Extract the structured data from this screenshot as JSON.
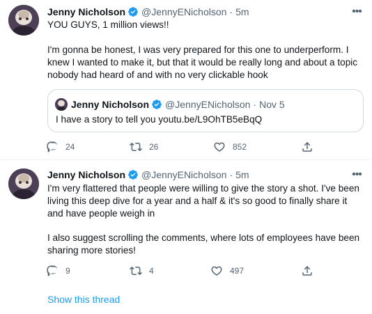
{
  "tweets": [
    {
      "author": "Jenny Nicholson",
      "handle": "@JennyENicholson",
      "time": "5m",
      "paragraphs": [
        "YOU GUYS, 1 million views!!",
        "I'm gonna be honest, I was very prepared for this one to underperform. I knew I wanted to make it, but that it would be really long and about a topic nobody had heard of and with no very clickable hook"
      ],
      "quote": {
        "author": "Jenny Nicholson",
        "handle": "@JennyENicholson",
        "time": "Nov 5",
        "text": "I have a story to tell you youtu.be/L9OhTB5eBqQ"
      },
      "replies": "24",
      "retweets": "26",
      "likes": "852"
    },
    {
      "author": "Jenny Nicholson",
      "handle": "@JennyENicholson",
      "time": "5m",
      "paragraphs": [
        "I'm very flattered that people were willing to give the story a shot. I've been living this deep dive for a year and a half & it's so good to finally share it and have people weigh in",
        "I also suggest scrolling the comments, where lots of employees have been sharing more stories!"
      ],
      "replies": "9",
      "retweets": "4",
      "likes": "497"
    }
  ],
  "separator": "·",
  "more_glyph": "•••",
  "show_thread": "Show this thread",
  "icons": {
    "verified": "verified-badge-icon",
    "more": "more-icon",
    "reply": "reply-icon",
    "retweet": "retweet-icon",
    "like": "like-icon",
    "share": "share-icon"
  },
  "colors": {
    "link": "#1d9bf0",
    "text": "#0f1419",
    "muted": "#536471",
    "border": "#cfd9de"
  }
}
